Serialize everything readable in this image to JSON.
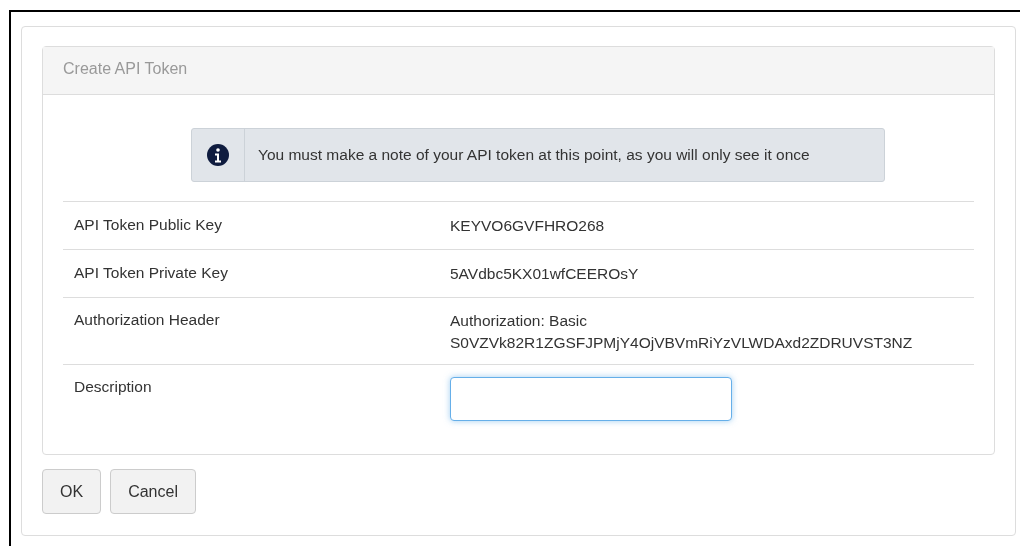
{
  "panel": {
    "title": "Create API Token"
  },
  "alert": {
    "text": "You must make a note of your API token at this point, as you will only see it once"
  },
  "rows": [
    {
      "kind": "text",
      "label": "API Token Public Key",
      "lines": [
        "KEYVO6GVFHRO268"
      ]
    },
    {
      "kind": "text",
      "label": "API Token Private Key",
      "lines": [
        "5AVdbc5KX01wfCEEROsY"
      ]
    },
    {
      "kind": "text",
      "label": "Authorization Header",
      "lines": [
        "Authorization: Basic",
        "S0VZVk82R1ZGSFJPMjY4OjVBVmRiYzVLWDAxd2ZDRUVST3NZ"
      ]
    },
    {
      "kind": "input",
      "label": "Description",
      "focused": true
    }
  ],
  "buttons": [
    "OK",
    "Cancel"
  ]
}
